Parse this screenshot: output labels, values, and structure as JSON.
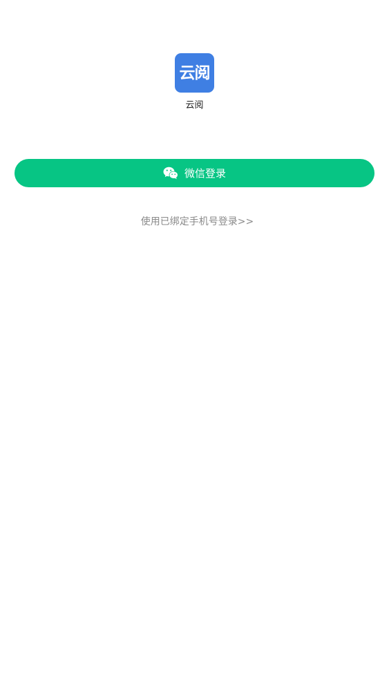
{
  "app": {
    "icon_text": "云阅",
    "name": "云阅"
  },
  "login": {
    "wechat_label": "微信登录",
    "wechat_icon": "wechat-icon",
    "phone_link": "使用已绑定手机号登录>>"
  },
  "colors": {
    "brand_blue": "#3f7fe3",
    "wechat_green": "#07c584",
    "link_gray": "#8a8a8a"
  }
}
